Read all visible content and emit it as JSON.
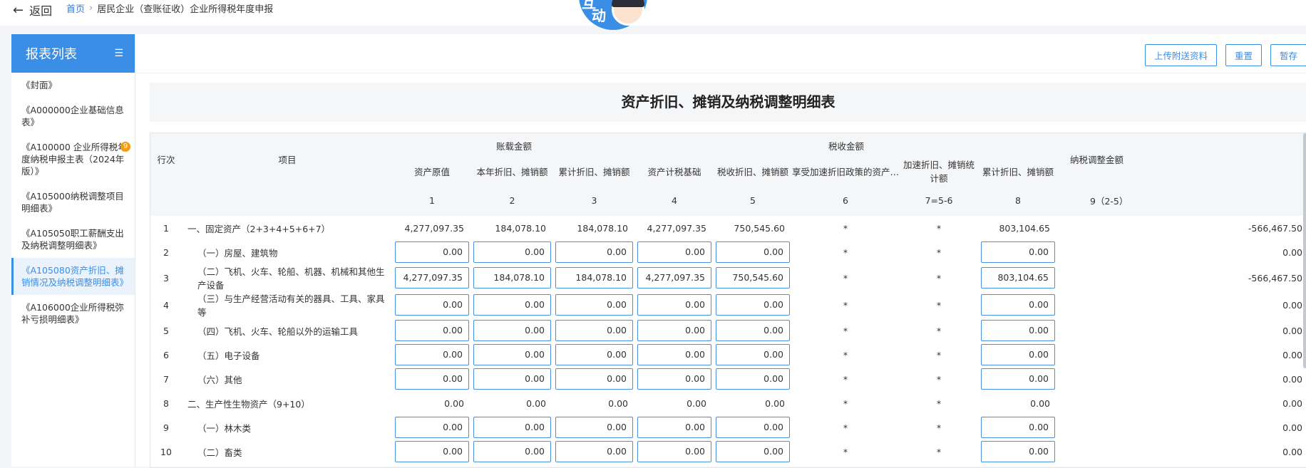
{
  "header": {
    "back_label": "返回",
    "breadcrumb_home": "首页",
    "breadcrumb_sep": "›",
    "breadcrumb_current": "居民企业（查账征收）企业所得税年度申报",
    "mascot_text_1": "互",
    "mascot_text_2": "动"
  },
  "sidebar": {
    "title": "报表列表",
    "menu_icon": "☰",
    "items": [
      {
        "label": "《封面》",
        "active": false
      },
      {
        "label": "《A000000企业基础信息表》",
        "active": false
      },
      {
        "label": "《A100000 企业所得税年度纳税申报主表（2024年版）》",
        "active": false,
        "badge": "9"
      },
      {
        "label": "《A105000纳税调整项目明细表》",
        "active": false
      },
      {
        "label": "《A105050职工薪酬支出及纳税调整明细表》",
        "active": false
      },
      {
        "label": "《A105080资产折旧、摊销情况及纳税调整明细表》",
        "active": true
      },
      {
        "label": "《A106000企业所得税弥补亏损明细表》",
        "active": false
      }
    ]
  },
  "toolbar": {
    "upload_label": "上传附送资料",
    "reset_label": "重置",
    "save_label": "暂存"
  },
  "form_title": "资产折旧、摊销及纳税调整明细表",
  "table": {
    "group_book": "账载金额",
    "group_tax": "税收金额",
    "col_row": "行次",
    "col_item": "项目",
    "col_names": [
      "资产原值",
      "本年折旧、摊销额",
      "累计折旧、摊销额",
      "资产计税基础",
      "税收折旧、摊销额",
      "享受加速折旧政策的资产…",
      "加速折旧、摊销统计额",
      "累计折旧、摊销额",
      "纳税调整金额"
    ],
    "col_nums": [
      "1",
      "2",
      "3",
      "4",
      "5",
      "6",
      "7=5-6",
      "8",
      "9（2-5）"
    ],
    "rows": [
      {
        "no": "1",
        "item": "一、固定资产（2+3+4+5+6+7）",
        "indent": 0,
        "editable": false,
        "v": [
          "4,277,097.35",
          "184,078.10",
          "184,078.10",
          "4,277,097.35",
          "750,545.60",
          "*",
          "*",
          "803,104.65",
          "-566,467.50"
        ]
      },
      {
        "no": "2",
        "item": "（一）房屋、建筑物",
        "indent": 1,
        "editable": true,
        "v": [
          "0.00",
          "0.00",
          "0.00",
          "0.00",
          "0.00",
          "*",
          "*",
          "0.00",
          "0.00"
        ]
      },
      {
        "no": "3",
        "item": "（二）飞机、火车、轮船、机器、机械和其他生产设备",
        "indent": 1,
        "editable": true,
        "v": [
          "4,277,097.35",
          "184,078.10",
          "184,078.10",
          "4,277,097.35",
          "750,545.60",
          "*",
          "*",
          "803,104.65",
          "-566,467.50"
        ]
      },
      {
        "no": "4",
        "item": "（三）与生产经营活动有关的器具、工具、家具等",
        "indent": 1,
        "editable": true,
        "v": [
          "0.00",
          "0.00",
          "0.00",
          "0.00",
          "0.00",
          "*",
          "*",
          "0.00",
          "0.00"
        ]
      },
      {
        "no": "5",
        "item": "（四）飞机、火车、轮船以外的运输工具",
        "indent": 1,
        "editable": true,
        "v": [
          "0.00",
          "0.00",
          "0.00",
          "0.00",
          "0.00",
          "*",
          "*",
          "0.00",
          "0.00"
        ]
      },
      {
        "no": "6",
        "item": "（五）电子设备",
        "indent": 1,
        "editable": true,
        "v": [
          "0.00",
          "0.00",
          "0.00",
          "0.00",
          "0.00",
          "*",
          "*",
          "0.00",
          "0.00"
        ]
      },
      {
        "no": "7",
        "item": "（六）其他",
        "indent": 1,
        "editable": true,
        "v": [
          "0.00",
          "0.00",
          "0.00",
          "0.00",
          "0.00",
          "*",
          "*",
          "0.00",
          "0.00"
        ]
      },
      {
        "no": "8",
        "item": "二、生产性生物资产（9+10）",
        "indent": 0,
        "editable": false,
        "v": [
          "0.00",
          "0.00",
          "0.00",
          "0.00",
          "0.00",
          "*",
          "*",
          "0.00",
          "0.00"
        ]
      },
      {
        "no": "9",
        "item": "（一）林木类",
        "indent": 1,
        "editable": true,
        "v": [
          "0.00",
          "0.00",
          "0.00",
          "0.00",
          "0.00",
          "*",
          "*",
          "0.00",
          "0.00"
        ]
      },
      {
        "no": "10",
        "item": "（二）畜类",
        "indent": 1,
        "editable": true,
        "v": [
          "0.00",
          "0.00",
          "0.00",
          "0.00",
          "0.00",
          "*",
          "*",
          "0.00",
          "0.00"
        ]
      }
    ]
  }
}
